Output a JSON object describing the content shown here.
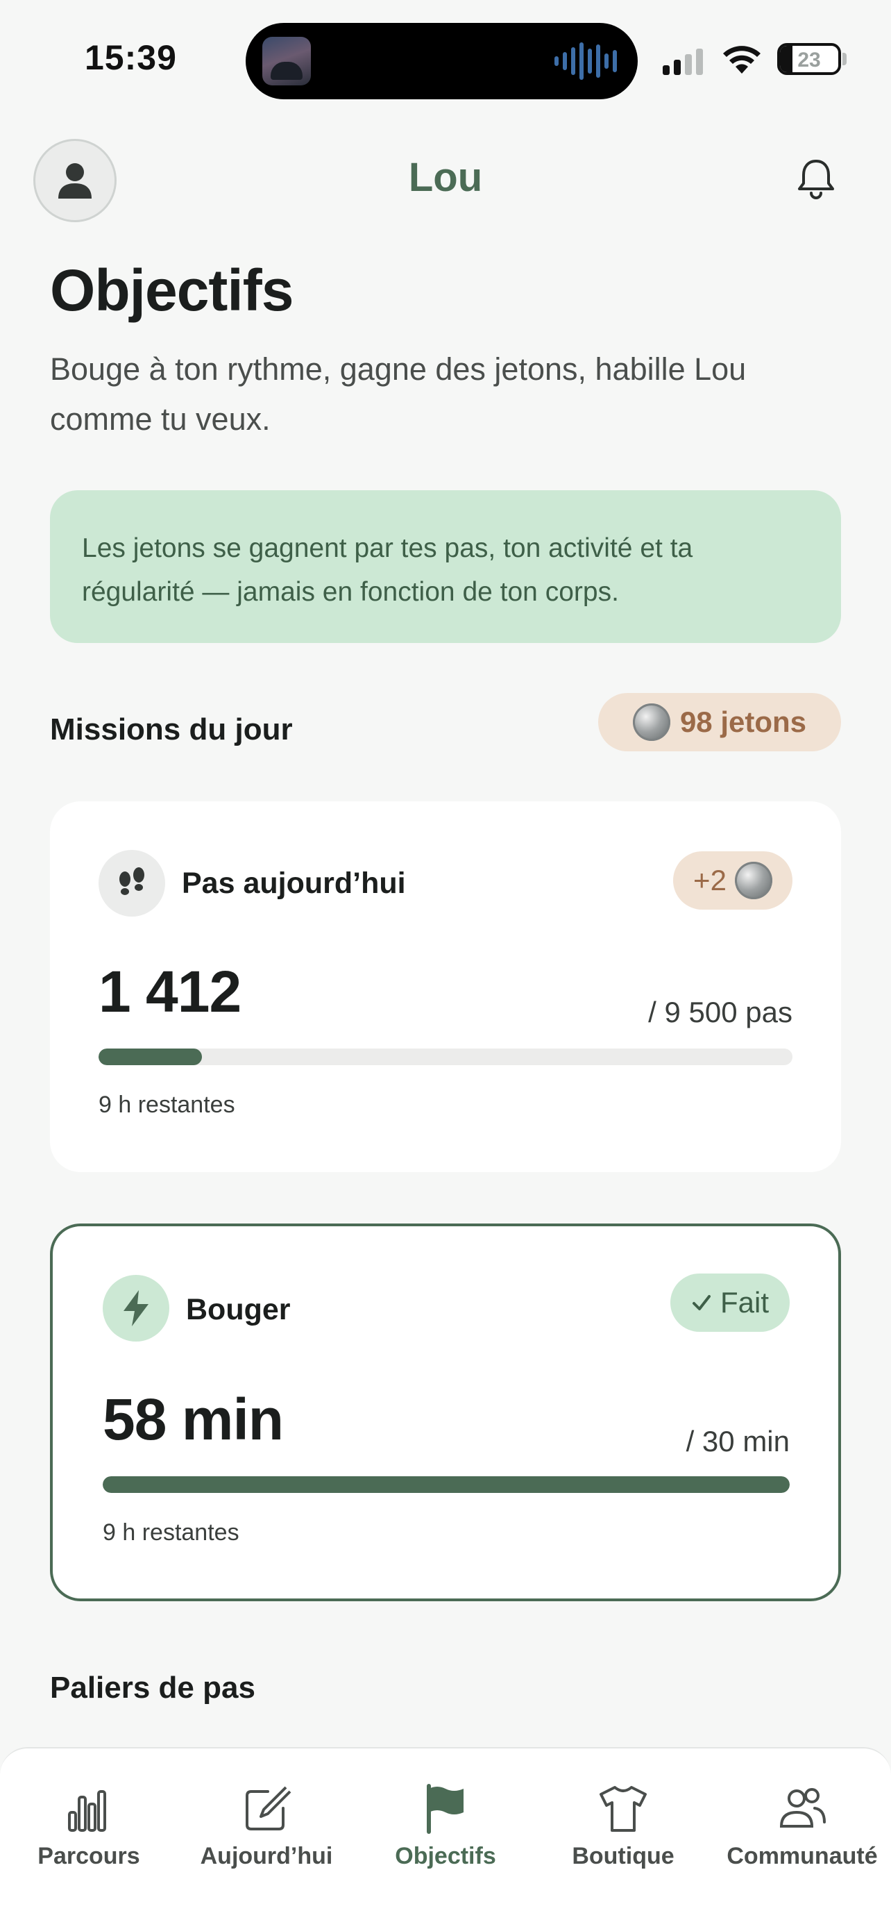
{
  "status_bar": {
    "time": "15:39",
    "battery": "23"
  },
  "header": {
    "title": "Lou",
    "avatar_icon": "person-icon",
    "notification_icon": "bell-icon"
  },
  "page": {
    "title": "Objectifs",
    "subtitle": "Bouge à ton rythme, gagne des jetons, habille Lou comme tu veux."
  },
  "info_banner": {
    "text": "Les jetons se gagnent par tes pas, ton activité et ta régularité — jamais en fonction de ton corps."
  },
  "missions": {
    "heading": "Missions du jour",
    "tokens_label": "98 jetons",
    "tokens_count": 98,
    "cards": [
      {
        "label": "Pas aujourd’hui",
        "icon": "footprints-icon",
        "badge": "+2",
        "value": "1 412",
        "target": "/ 9 500 pas",
        "progress": 0.149,
        "remaining": "9 h restantes",
        "completed": false
      },
      {
        "label": "Bouger",
        "icon": "lightning-icon",
        "badge": "Fait",
        "value": "58 min",
        "target": "/ 30 min",
        "progress": 1.0,
        "remaining": "9 h restantes",
        "completed": true
      }
    ]
  },
  "step_tiers": {
    "heading": "Paliers de pas"
  },
  "tab_bar": {
    "tabs": [
      {
        "label": "Parcours",
        "icon": "bar-chart-icon",
        "active": false
      },
      {
        "label": "Aujourd’hui",
        "icon": "edit-icon",
        "active": false
      },
      {
        "label": "Objectifs",
        "icon": "flag-icon",
        "active": true
      },
      {
        "label": "Boutique",
        "icon": "tshirt-icon",
        "active": false
      },
      {
        "label": "Communauté",
        "icon": "people-icon",
        "active": false
      }
    ]
  },
  "colors": {
    "accent": "#4b6b55",
    "banner_bg": "#cce8d4",
    "token_pill_bg": "#f1e2d4",
    "token_text": "#9b6a48",
    "background": "#f6f7f6"
  }
}
